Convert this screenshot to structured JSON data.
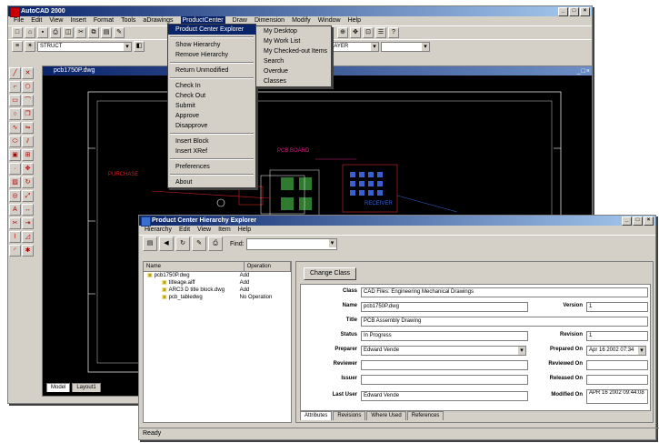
{
  "cad": {
    "title": "AutoCAD 2000",
    "menus": [
      "File",
      "Edit",
      "View",
      "Insert",
      "Format",
      "Tools",
      "aDrawings",
      "ProductCenter",
      "Draw",
      "Dimension",
      "Modify",
      "Window",
      "Help"
    ],
    "active_menu": "ProductCenter",
    "layer_combo": "STRUCT",
    "layer_combo2": "BYLAYER",
    "drawing_title": "pcb1750P.dwg",
    "layout_tab": "Model",
    "layout_tab2": "Layout1"
  },
  "menu_pc": {
    "items": [
      "Product Center Explorer",
      "Show Hierarchy",
      "Remove Hierarchy",
      "Return Unmodified",
      "Check In",
      "Check Out",
      "Submit",
      "Approve",
      "Disapprove",
      "Insert Block",
      "Insert XRef",
      "Preferences",
      "About"
    ]
  },
  "submenu": {
    "items": [
      "My Desktop",
      "My Work List",
      "My Checked-out Items",
      "Search",
      "Overdue",
      "Classes"
    ]
  },
  "cad_labels": {
    "label_a": "PURCHASE",
    "label_b": "PCB BOARD",
    "label_c": "RECEIVER"
  },
  "explorer": {
    "title": "Product Center Hierarchy Explorer",
    "menus": [
      "Hierarchy",
      "Edit",
      "View",
      "Item",
      "Help"
    ],
    "find_label": "Find:",
    "tree_headers": [
      "Name",
      "Operation"
    ],
    "tree_items": [
      {
        "name": "pcb1750P.dwg",
        "op": "Add"
      },
      {
        "name": "titleage.aiff",
        "op": "Add"
      },
      {
        "name": "ARC3 D title block.dwg",
        "op": "Add"
      },
      {
        "name": "pcb_tabledwg",
        "op": "No Operation"
      }
    ],
    "change_class_btn": "Change Class",
    "status": "Ready",
    "tabs": [
      "Attributes",
      "Revisions",
      "Where Used",
      "References"
    ],
    "fields": {
      "class_label": "Class",
      "class_value": "CAD Files: Engineering Mechanical Drawings",
      "name_label": "Name",
      "name_value": "pcb1750P.dwg",
      "version_label": "Version",
      "version_value": "1",
      "title_label": "Title",
      "title_value": "PCB Assembly Drawing",
      "status_label": "Status",
      "status_value": "In Progress",
      "revision_label": "Revision",
      "revision_value": "1",
      "preparer_label": "Preparer",
      "preparer_value": "Edward Vende",
      "prepared_on_label": "Prepared On",
      "prepared_on_value": "Apr 16 2002 07:34",
      "reviewer_label": "Reviewer",
      "reviewer_value": "",
      "reviewed_on_label": "Reviewed On",
      "reviewed_on_value": "",
      "issuer_label": "Issuer",
      "issuer_value": "",
      "released_on_label": "Released On",
      "released_on_value": "",
      "last_user_label": "Last User",
      "last_user_value": "Edward Vende",
      "modified_on_label": "Modified On",
      "modified_on_value": "APR 16 2002 09:44:08"
    }
  }
}
